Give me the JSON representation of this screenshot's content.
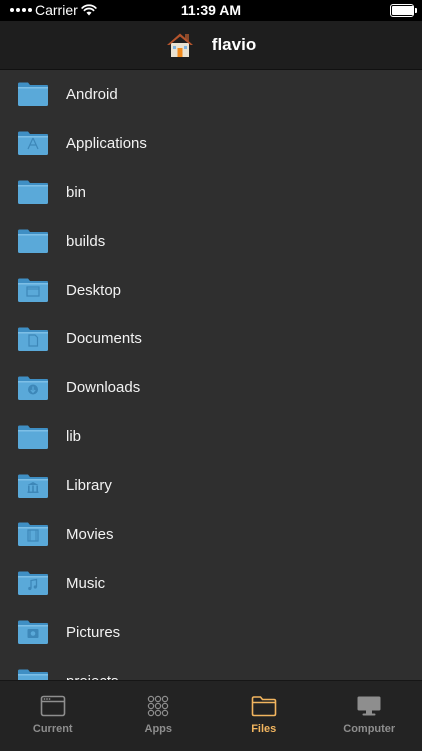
{
  "status": {
    "carrier": "Carrier",
    "time": "11:39 AM",
    "battery": 1.0
  },
  "header": {
    "title": "flavio",
    "icon": "home-icon"
  },
  "files": [
    {
      "name": "Android",
      "glyph": ""
    },
    {
      "name": "Applications",
      "glyph": "apps"
    },
    {
      "name": "bin",
      "glyph": ""
    },
    {
      "name": "builds",
      "glyph": ""
    },
    {
      "name": "Desktop",
      "glyph": "desktop"
    },
    {
      "name": "Documents",
      "glyph": "doc"
    },
    {
      "name": "Downloads",
      "glyph": "download"
    },
    {
      "name": "lib",
      "glyph": ""
    },
    {
      "name": "Library",
      "glyph": "library"
    },
    {
      "name": "Movies",
      "glyph": "movie"
    },
    {
      "name": "Music",
      "glyph": "music"
    },
    {
      "name": "Pictures",
      "glyph": "picture"
    },
    {
      "name": "projects",
      "glyph": ""
    }
  ],
  "tabs": [
    {
      "label": "Current",
      "icon": "window-icon",
      "active": false
    },
    {
      "label": "Apps",
      "icon": "grid-icon",
      "active": false
    },
    {
      "label": "Files",
      "icon": "folder-icon",
      "active": true
    },
    {
      "label": "Computer",
      "icon": "monitor-icon",
      "active": false
    }
  ],
  "colors": {
    "accent": "#f2b55f",
    "folder": "#5aa9d9",
    "background": "#2f2f2f"
  }
}
